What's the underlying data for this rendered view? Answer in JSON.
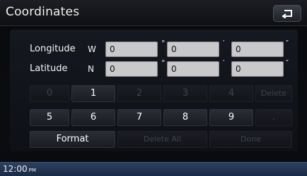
{
  "header": {
    "title": "Coordinates",
    "back_icon": "return-arrow-icon"
  },
  "coordinates": {
    "longitude": {
      "label": "Longitude",
      "direction": "W",
      "degrees": "0",
      "minutes": "0",
      "seconds": "0"
    },
    "latitude": {
      "label": "Latitude",
      "direction": "N",
      "degrees": "0",
      "minutes": "0",
      "seconds": "0"
    },
    "units": {
      "degree": "°",
      "minute": "′",
      "second": "″"
    }
  },
  "keypad": {
    "row1": [
      "0",
      "1",
      "2",
      "3",
      "4",
      "Delete"
    ],
    "row2": [
      "5",
      "6",
      "7",
      "8",
      "9",
      "."
    ],
    "format": "Format",
    "delete_all": "Delete All",
    "done": "Done",
    "disabled_keys": [
      "0",
      "2",
      "3",
      "4",
      "Delete",
      ".",
      "Delete All",
      "Done"
    ]
  },
  "status": {
    "time": "12:00",
    "ampm": "PM"
  },
  "colors": {
    "field_bg": "#c9c9cc",
    "statusbar": "#2c4060",
    "disabled_text": "#3f424b"
  }
}
